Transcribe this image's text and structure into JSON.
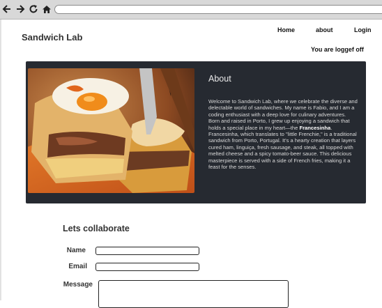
{
  "header": {
    "brand": "Sandwich Lab",
    "nav": [
      "Home",
      "about",
      "Login"
    ],
    "status": "You are loggef off"
  },
  "about": {
    "title": "About",
    "intro": "Welcome to Sandwich Lab, where we celebrate the diverse and delectable world of sandwiches. My name is Fabio, and I am a coding enthusiast with a deep love for culinary adventures. Born and raised in Porto, I grew up enjoying a sandwich that holds a special place in my heart—the",
    "highlight": "Francesinha",
    "intro_end": ".",
    "description": "Francesinha, which translates to \"little Frenchie,\" is a traditional sandwich from Porto, Portugal. It's a hearty creation that layers cured ham, linguiça, fresh sausage, and steak, all topped with melted cheese and a spicy tomato-beer sauce. This delicious masterpiece is served with a side of French fries, making it a feast for the senses.",
    "image_icon": "francesinha-photo"
  },
  "form": {
    "title": "Lets collaborate",
    "name_label": "Name",
    "email_label": "Email",
    "message_label": "Message",
    "name_value": "",
    "email_value": "",
    "message_value": ""
  },
  "browser": {
    "icons": [
      "back-icon",
      "forward-icon",
      "reload-icon",
      "home-icon"
    ]
  }
}
